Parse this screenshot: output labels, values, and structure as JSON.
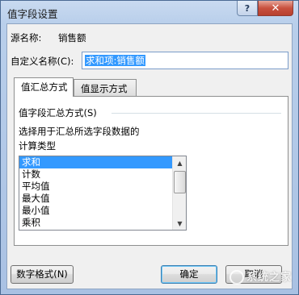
{
  "window": {
    "title": "值字段设置"
  },
  "source": {
    "label": "源名称:",
    "value": "销售额"
  },
  "custom_name": {
    "label": "自定义名称(C):",
    "value": "求和项:销售额"
  },
  "tabs": [
    {
      "label": "值汇总方式",
      "active": true
    },
    {
      "label": "值显示方式",
      "active": false
    }
  ],
  "summary": {
    "group_label": "值字段汇总方式(S)",
    "description_line1": "选择用于汇总所选字段数据的",
    "description_line2": "计算类型",
    "options": [
      "求和",
      "计数",
      "平均值",
      "最大值",
      "最小值",
      "乘积"
    ],
    "selected": "求和"
  },
  "buttons": {
    "number_format": "数字格式(N)",
    "ok": "确定",
    "cancel": "取消"
  },
  "watermark": "系统之家",
  "colors": {
    "selection": "#3399ff",
    "title_gradient": "#b9cfeb",
    "close_button": "#c8513f"
  }
}
